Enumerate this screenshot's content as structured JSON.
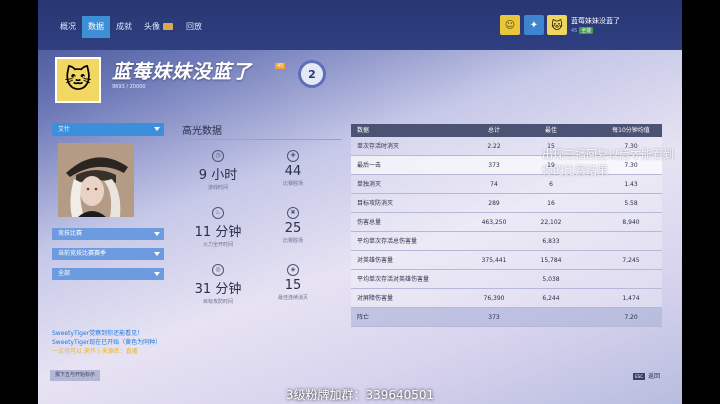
{
  "tabs": [
    {
      "label": "概况"
    },
    {
      "label": "数据"
    },
    {
      "label": "成就"
    },
    {
      "label": "头像"
    },
    {
      "label": "回放"
    }
  ],
  "profile": {
    "name": "蓝莓妹妹没蓝了",
    "mini_name": "蓝莓妹妹没蓝了",
    "mini_level": "45",
    "mini_badge": "全能",
    "level_tag": "45",
    "xp": "9693 / 20000",
    "prestige": "2"
  },
  "hero_selector": {
    "selected": "艾什"
  },
  "filters": [
    {
      "label": "竞技比赛"
    },
    {
      "label": "当前竞技比赛赛季"
    },
    {
      "label": "全部"
    }
  ],
  "highlights": {
    "title": "高光数据",
    "items": [
      {
        "icon": "clock-icon",
        "value": "9 小时",
        "label": "游戏时间"
      },
      {
        "icon": "crosshair-icon",
        "value": "44",
        "label": "比赛胜场"
      },
      {
        "icon": "fire-icon",
        "value": "11 分钟",
        "label": "火力全开时间"
      },
      {
        "icon": "sword-icon",
        "value": "25",
        "label": "比赛胜场"
      },
      {
        "icon": "target-icon",
        "value": "31 分钟",
        "label": "目标攻防时间"
      },
      {
        "icon": "shield-icon",
        "value": "15",
        "label": "最佳连续消灭"
      }
    ]
  },
  "table": {
    "headers": [
      "数据",
      "总计",
      "最佳",
      "每10分钟均值"
    ],
    "rows": [
      [
        "单次存活时消灭",
        "2.22",
        "15",
        "7.30"
      ],
      [
        "最后一击",
        "373",
        "19",
        "7.30"
      ],
      [
        "单独消灭",
        "74",
        "6",
        "1.43"
      ],
      [
        "目标攻防消灭",
        "289",
        "16",
        "5.58"
      ],
      [
        "伤害总量",
        "463,250",
        "22,102",
        "8,940"
      ],
      [
        "平均单次存活总伤害量",
        "",
        "6,833",
        ""
      ],
      [
        "对英雄伤害量",
        "375,441",
        "15,784",
        "7,245"
      ],
      [
        "平均单次存活对英雄伤害量",
        "",
        "5,038",
        ""
      ],
      [
        "对屏障伤害量",
        "76,390",
        "6,244",
        "1,474"
      ],
      [
        "阵亡",
        "373",
        "",
        "7.20"
      ]
    ]
  },
  "chat": [
    "SweetyTiger觉察到你还能看见！",
    "SweetyTiger现在已开始（黄色为同种）",
    "一点也可以 来作 | 来源名：直播"
  ],
  "report_button": "报下五与开始标示",
  "back": {
    "esc": "ESC",
    "label": "返回"
  },
  "overlay_text": "出现三播回复以后才能看到你的比赛结果",
  "watermark": "3级粉牌加群：339640501",
  "colors": {
    "accent": "#3d8fd6",
    "topbar": "#283672",
    "chat_blue": "#1f7be0",
    "chat_gold": "#e9b52d"
  }
}
